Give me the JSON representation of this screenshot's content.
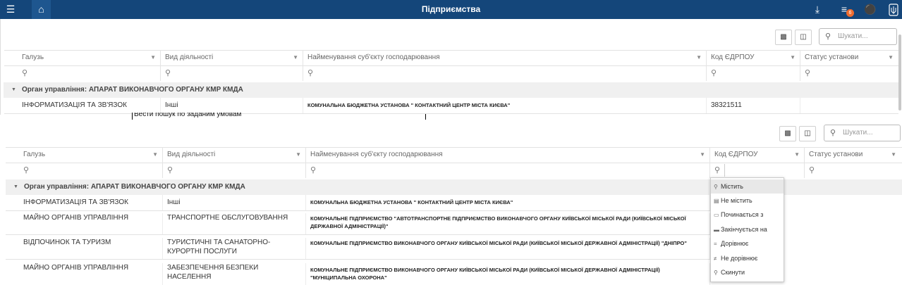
{
  "app": {
    "title": "Підприємства",
    "badge_count": "6",
    "accent": "#14467a"
  },
  "panel_top": {
    "search_placeholder": "Шукати...",
    "columns": [
      "Галузь",
      "Вид діяльності",
      "Найменування суб'єкту господарювання",
      "Код ЄДРПОУ",
      "Статус установи"
    ],
    "group_label": "Орган управління: АПАРАТ ВИКОНАВЧОГО ОРГАНУ КМР КМДА",
    "rows": [
      [
        "ІНФОРМАТИЗАЦІЯ ТА ЗВ'ЯЗОК",
        "Інші",
        "КОМУНАЛЬНА БЮДЖЕТНА УСТАНОВА \" КОНТАКТНИЙ ЦЕНТР МІСТА КИЄВА\"",
        "38321511",
        ""
      ]
    ],
    "tooltip": "Вести пошук по заданим умовам"
  },
  "panel_bottom": {
    "search_placeholder": "Шукати...",
    "columns": [
      "Галузь",
      "Вид діяльності",
      "Найменування суб'єкту господарювання",
      "Код ЄДРПОУ",
      "Статус установи"
    ],
    "group_label": "Орган управління: АПАРАТ ВИКОНАВЧОГО ОРГАНУ КМР КМДА",
    "rows": [
      [
        "ІНФОРМАТИЗАЦІЯ ТА ЗВ'ЯЗОК",
        "Інші",
        "КОМУНАЛЬНА БЮДЖЕТНА УСТАНОВА \" КОНТАКТНИЙ ЦЕНТР МІСТА КИЄВА\""
      ],
      [
        "МАЙНО ОРГАНІВ УПРАВЛІННЯ",
        "ТРАНСПОРТНЕ ОБСЛУГОВУВАННЯ",
        "КОМУНАЛЬНЕ ПІДПРИЄМСТВО \"АВТОТРАНСПОРТНЕ ПІДПРИЄМСТВО ВИКОНАВЧОГО ОРГАНУ КИЇВСЬКОЇ МІСЬКОЇ РАДИ (КИЇВСЬКОЇ МІСЬКОЇ ДЕРЖАВНОЇ АДМІНІСТРАЦІЇ)\""
      ],
      [
        "ВІДПОЧИНОК ТА ТУРИЗМ",
        "ТУРИСТИЧНІ ТА САНАТОРНО-КУРОРТНІ ПОСЛУГИ",
        "КОМУНАЛЬНЕ ПІДПРИЄМСТВО ВИКОНАВЧОГО ОРГАНУ КИЇВСЬКОЇ МІСЬКОЇ РАДИ (КИЇВСЬКОЇ МІСЬКОЇ ДЕРЖАВНОЇ АДМІНІСТРАЦІЇ) \"ДНІПРО\""
      ],
      [
        "МАЙНО ОРГАНІВ УПРАВЛІННЯ",
        "ЗАБЕЗПЕЧЕННЯ БЕЗПЕКИ НАСЕЛЕННЯ",
        "КОМУНАЛЬНЕ ПІДПРИЄМСТВО ВИКОНАВЧОГО ОРГАНУ КИЇВСЬКОЇ МІСЬКОЇ РАДИ (КИЇВСЬКОЇ МІСЬКОЇ ДЕРЖАВНОЇ АДМІНІСТРАЦІЇ) \"МУНІЦИПАЛЬНА ОХОРОНА\""
      ]
    ],
    "filter_menu": [
      {
        "icon": "contains-icon",
        "label": "Містить"
      },
      {
        "icon": "not-contains-icon",
        "label": "Не містить"
      },
      {
        "icon": "starts-with-icon",
        "label": "Починається з"
      },
      {
        "icon": "ends-with-icon",
        "label": "Закінчується на"
      },
      {
        "icon": "equals-icon",
        "label": "Дорівнює"
      },
      {
        "icon": "not-equals-icon",
        "label": "Не дорівнює"
      },
      {
        "icon": "reset-icon",
        "label": "Скинути"
      }
    ]
  }
}
